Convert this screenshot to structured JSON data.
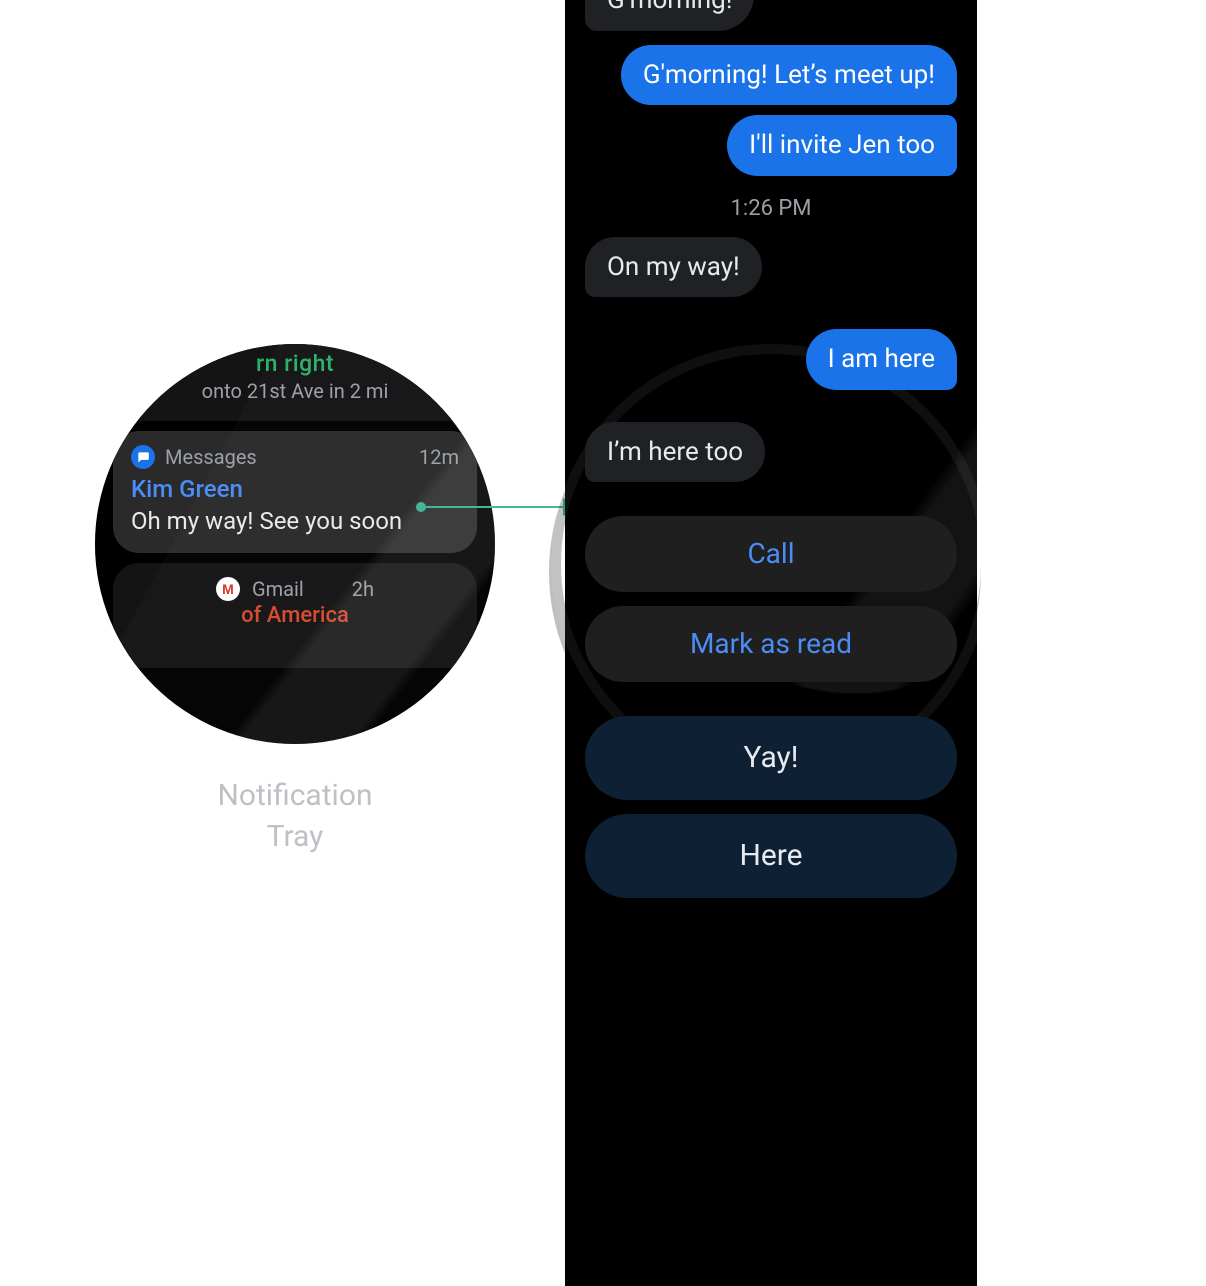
{
  "caption": "Notification Tray",
  "notifications": {
    "maps": {
      "line1_fragment": "rn right",
      "line2": "onto 21st Ave in 2 mi"
    },
    "messages": {
      "app": "Messages",
      "age": "12m",
      "sender": "Kim Green",
      "body": "Oh my way! See you soon"
    },
    "gmail": {
      "app": "Gmail",
      "age": "2h",
      "sender_fragment": "of America"
    }
  },
  "conversation": {
    "messages": [
      {
        "side": "in",
        "text": "G’morning!"
      },
      {
        "side": "out",
        "text": "G'morning! Let’s meet up!"
      },
      {
        "side": "out",
        "text": "I'll invite Jen too"
      }
    ],
    "timestamp": "1:26 PM",
    "messages2": [
      {
        "side": "in",
        "text": "On my way!"
      },
      {
        "side": "out",
        "text": "I am here"
      },
      {
        "side": "in",
        "text": "I’m here too"
      }
    ],
    "actions": [
      {
        "label": "Call"
      },
      {
        "label": "Mark as read"
      }
    ],
    "suggestions": [
      {
        "label": "Yay!"
      },
      {
        "label": "Here"
      }
    ]
  },
  "colors": {
    "link_blue": "#4b8cf5",
    "bubble_out": "#1a73e8",
    "bubble_in": "#202124",
    "suggest_bg": "#0d2034",
    "maps_green": "#29b06a",
    "gmail_red": "#d7482e"
  }
}
